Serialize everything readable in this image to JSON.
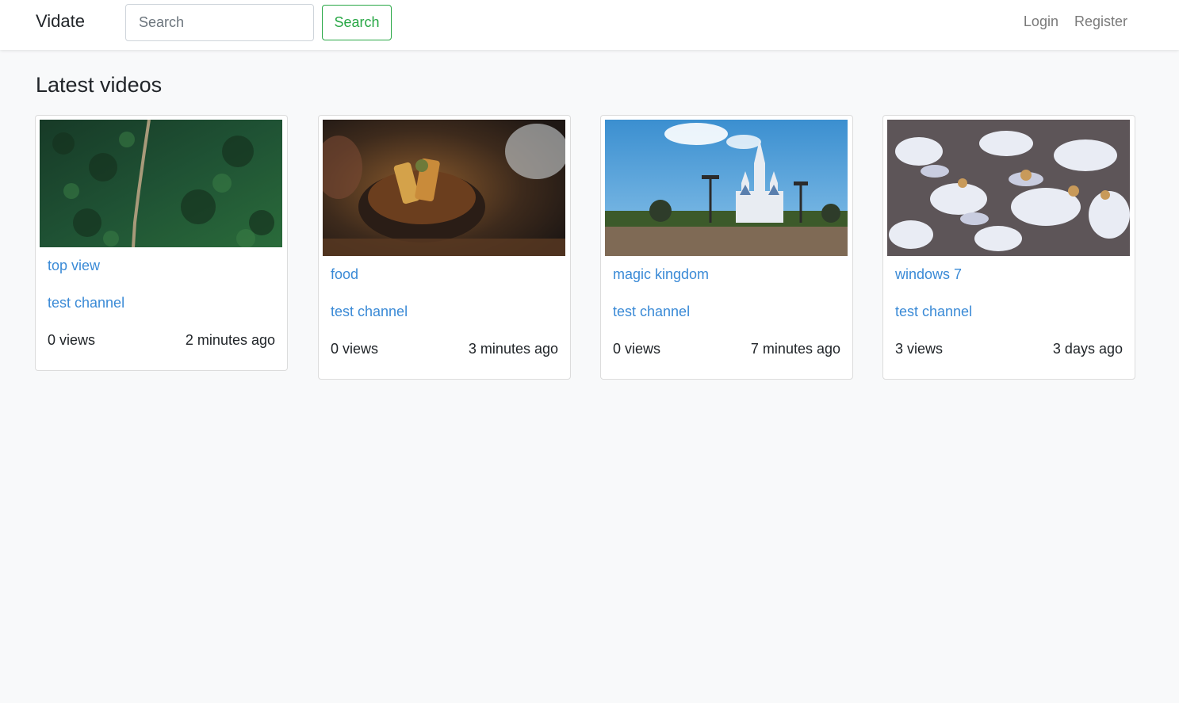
{
  "navbar": {
    "brand": "Vidate",
    "search_placeholder": "Search",
    "search_button": "Search",
    "login": "Login",
    "register": "Register"
  },
  "page": {
    "title": "Latest videos"
  },
  "videos": [
    {
      "title": "top view",
      "channel": "test channel",
      "views": "0 views",
      "time": "2 minutes ago",
      "thumbnail": "forest-road-aerial-thumbnail"
    },
    {
      "title": "food",
      "channel": "test channel",
      "views": "0 views",
      "time": "3 minutes ago",
      "thumbnail": "food-dish-thumbnail"
    },
    {
      "title": "magic kingdom",
      "channel": "test channel",
      "views": "0 views",
      "time": "7 minutes ago",
      "thumbnail": "castle-thumbnail"
    },
    {
      "title": "windows 7",
      "channel": "test channel",
      "views": "3 views",
      "time": "3 days ago",
      "thumbnail": "birds-thumbnail"
    }
  ]
}
